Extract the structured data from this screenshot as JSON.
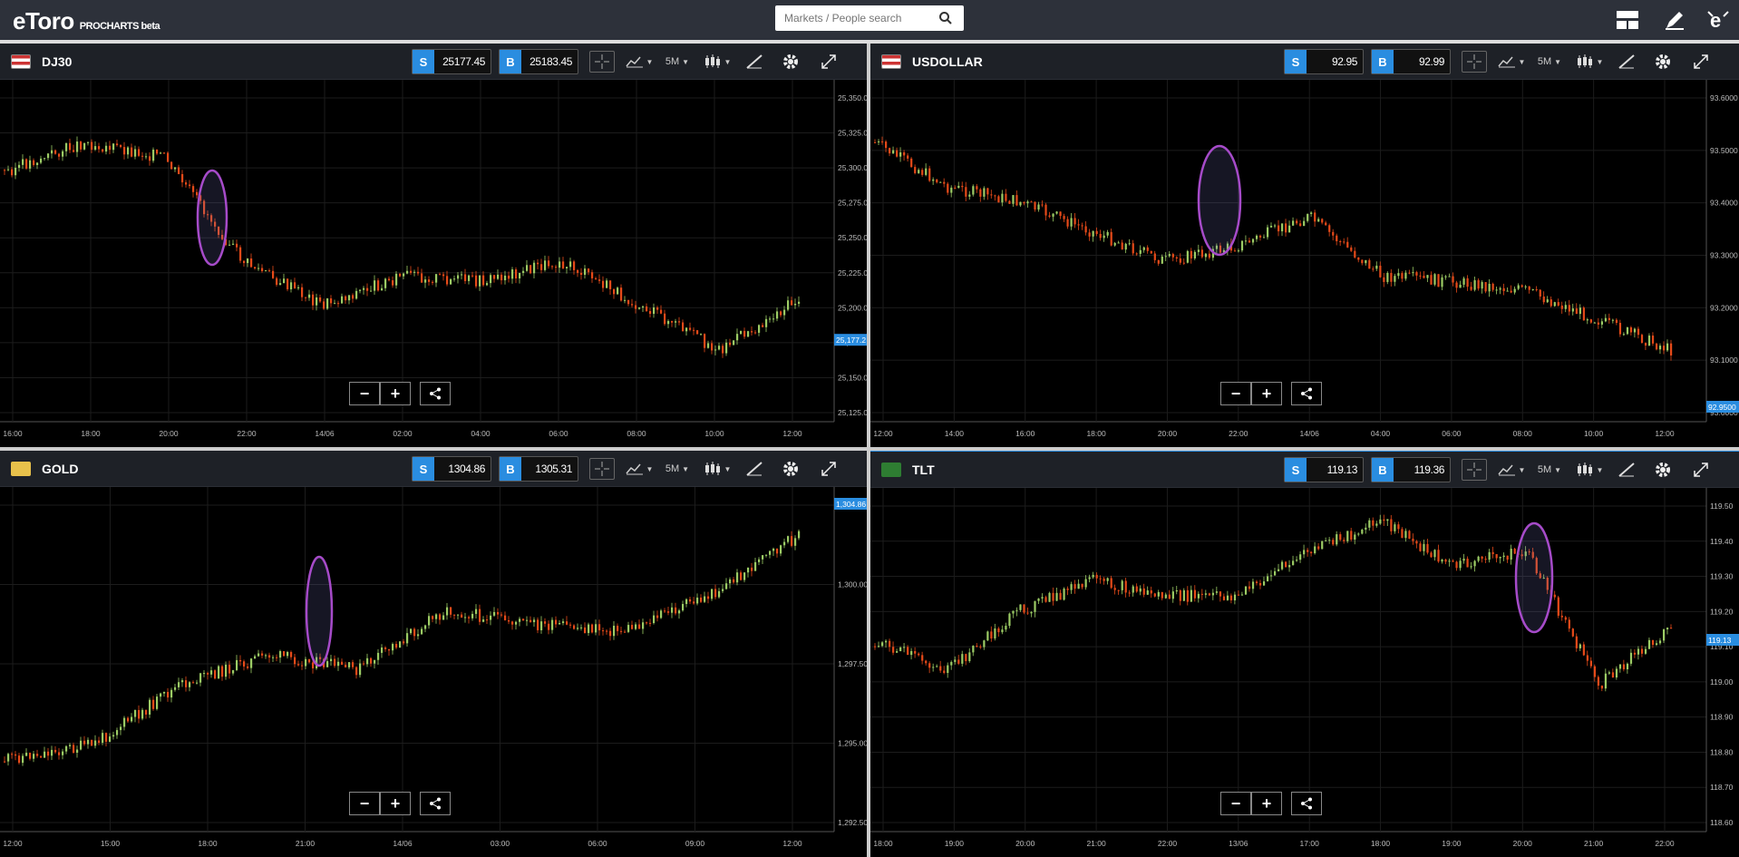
{
  "topbar": {
    "logo": "eToro",
    "sub": "PROCHARTS beta",
    "search_placeholder": "Markets / People search"
  },
  "colors": {
    "up": "#9ccc65",
    "down": "#e64a19",
    "accent": "#2a8de0",
    "highlight": "#a64bc9"
  },
  "panes": [
    {
      "name": "DJ30",
      "sell": "25177.45",
      "buy": "25183.45",
      "timeframe": "5M",
      "last_price": "25,177.2",
      "y_ticks": [
        "25,350.0",
        "25,325.0",
        "25,300.0",
        "25,275.0",
        "25,250.0",
        "25,225.0",
        "25,200.0",
        "25,175.0",
        "25,150.0",
        "25,125.0"
      ],
      "x_ticks": [
        "16:00",
        "18:00",
        "20:00",
        "22:00",
        "14/06",
        "02:00",
        "04:00",
        "06:00",
        "08:00",
        "10:00",
        "12:00"
      ]
    },
    {
      "name": "USDOLLAR",
      "sell": "92.95",
      "buy": "92.99",
      "timeframe": "5M",
      "last_price": "92.9500",
      "y_ticks": [
        "93.6000",
        "93.5000",
        "93.4000",
        "93.3000",
        "93.2000",
        "93.1000",
        "93.0000"
      ],
      "x_ticks": [
        "12:00",
        "14:00",
        "16:00",
        "18:00",
        "20:00",
        "22:00",
        "14/06",
        "04:00",
        "06:00",
        "08:00",
        "10:00",
        "12:00"
      ]
    },
    {
      "name": "GOLD",
      "sell": "1304.86",
      "buy": "1305.31",
      "timeframe": "5M",
      "last_price": "1,304.86",
      "y_ticks": [
        "1,302.50",
        "1,300.00",
        "1,297.50",
        "1,295.00",
        "1,292.50"
      ],
      "x_ticks": [
        "12:00",
        "15:00",
        "18:00",
        "21:00",
        "14/06",
        "03:00",
        "06:00",
        "09:00",
        "12:00"
      ]
    },
    {
      "name": "TLT",
      "sell": "119.13",
      "buy": "119.36",
      "timeframe": "5M",
      "last_price": "119.13",
      "y_ticks": [
        "119.50",
        "119.40",
        "119.30",
        "119.20",
        "119.10",
        "119.00",
        "118.90",
        "118.80",
        "118.70",
        "118.60"
      ],
      "x_ticks": [
        "18:00",
        "19:00",
        "20:00",
        "21:00",
        "22:00",
        "13/06",
        "17:00",
        "18:00",
        "19:00",
        "20:00",
        "21:00",
        "22:00"
      ]
    }
  ]
}
